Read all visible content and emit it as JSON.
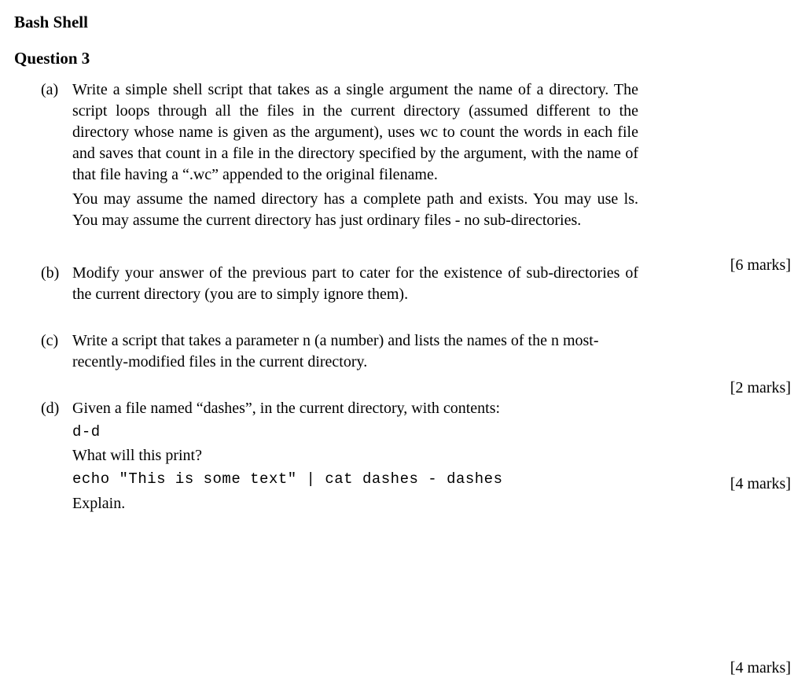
{
  "section_title": "Bash Shell",
  "question_title": "Question 3",
  "parts": {
    "a": {
      "label": "(a)",
      "p1": "Write a simple shell script that takes as a single argument the name of a directory. The script loops through all the files in the current directory (assumed different to the directory whose name is given as the argument), uses wc to count the words in each file and saves that count in a file in the directory specified by the argument, with the name of that file having a “.wc” appended to the original filename.",
      "p2": "You may assume the named directory has a complete path and exists. You may use ls. You may assume the current directory has just ordinary files - no sub-directories.",
      "marks": "[6 marks]"
    },
    "b": {
      "label": "(b)",
      "p1": "Modify your answer of the previous part to cater for the existence of sub-directories of the current directory (you are to simply ignore them).",
      "marks": "[2 marks]"
    },
    "c": {
      "label": "(c)",
      "p1": "Write a script that takes a parameter n (a number) and lists the names of the n most-recently-modified files in the current directory.",
      "marks": "[4 marks]"
    },
    "d": {
      "label": "(d)",
      "p1": "Given a file named “dashes”, in the current directory, with contents:",
      "code1": "d-d",
      "p2": "What will this print?",
      "code2": "echo \"This is some text\" | cat dashes - dashes",
      "p3": "Explain.",
      "marks": "[4 marks]"
    }
  }
}
